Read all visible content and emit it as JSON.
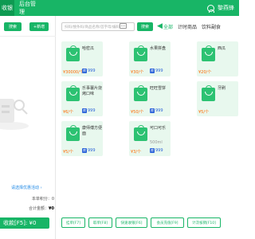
{
  "topbar": {
    "tab_cashier": "收银",
    "tab_admin": "后台管理",
    "user_name": "黎燕锋"
  },
  "left": {
    "search_label": "搜索",
    "add_label": "+新增",
    "tips_link": "请选择优惠活动 ›",
    "points_label": "本单积分：0",
    "total_label": "合计金额：",
    "total_value": "¥0",
    "pay_label": "收款[F5]: ¥0"
  },
  "main": {
    "search_placeholder": "扫码/搜条码/商品名称/首字母/编码",
    "search_label": "搜索",
    "categories": [
      "全部",
      "计时商品",
      "饮料副食"
    ]
  },
  "products": [
    {
      "name": "哈密瓜",
      "spec": "",
      "price": "¥30000/个",
      "stock": "999"
    },
    {
      "name": "水果拼盘",
      "spec": "",
      "price": "¥30/个",
      "stock": "999"
    },
    {
      "name": "西瓜",
      "spec": "",
      "price": "¥20/个",
      "stock": ""
    },
    {
      "name": "乐事薯片烧烤口味",
      "spec": "",
      "price": "¥6/个",
      "stock": "999"
    },
    {
      "name": "旺旺雪饼",
      "spec": "",
      "price": "¥50/个",
      "stock": "999"
    },
    {
      "name": "牙刷",
      "spec": "",
      "price": "¥5/个",
      "stock": ""
    },
    {
      "name": "康师傅方便面",
      "spec": "",
      "price": "¥5/个",
      "stock": "999"
    },
    {
      "name": "可口可乐",
      "spec": "500ml",
      "price": "¥3/个",
      "stock": "999"
    }
  ],
  "actions": [
    "挂单[F7]",
    "取单[F8]",
    "快速收银[F6]",
    "会员充值[F9]",
    "计次核销[F10]"
  ],
  "colors": {
    "brand": "#18b566",
    "price": "#ff6a00",
    "card_bg": "#e8f8ee"
  }
}
